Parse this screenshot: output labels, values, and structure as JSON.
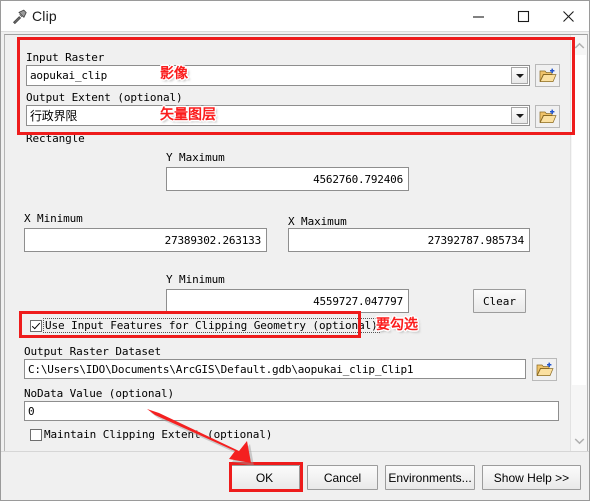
{
  "window": {
    "title": "Clip",
    "icon": "hammer-icon",
    "controls": {
      "minimize": "minimize-icon",
      "maximize": "maximize-icon",
      "close": "close-icon"
    }
  },
  "form": {
    "input_raster": {
      "label": "Input Raster",
      "value": "aopukai_clip",
      "browse_icon": "folder-open-add-icon",
      "dropdown_icon": "chevron-down-icon"
    },
    "output_extent": {
      "label": "Output Extent (optional)",
      "value": "行政界限",
      "browse_icon": "folder-open-add-icon",
      "dropdown_icon": "chevron-down-icon"
    },
    "rectangle": {
      "label": "Rectangle",
      "y_maximum": {
        "label": "Y Maximum",
        "value": "4562760.792406"
      },
      "x_minimum": {
        "label": "X Minimum",
        "value": "27389302.263133"
      },
      "x_maximum": {
        "label": "X Maximum",
        "value": "27392787.985734"
      },
      "y_minimum": {
        "label": "Y Minimum",
        "value": "4559727.047797"
      },
      "clear_button": "Clear"
    },
    "use_input_features": {
      "label": "Use Input Features for Clipping Geometry (optional)",
      "checked": "true"
    },
    "output_raster_dataset": {
      "label": "Output Raster Dataset",
      "value": "C:\\Users\\IDO\\Documents\\ArcGIS\\Default.gdb\\aopukai_clip_Clip1",
      "browse_icon": "folder-open-add-icon"
    },
    "nodata_value": {
      "label": "NoData Value (optional)",
      "value": "0"
    },
    "maintain_clipping_extent": {
      "label": "Maintain Clipping Extent (optional)",
      "checked": "false"
    }
  },
  "footer": {
    "ok": "OK",
    "cancel": "Cancel",
    "environments": "Environments...",
    "show_help": "Show Help >>"
  },
  "scrollbar": {
    "up_icon": "chevron-up-icon",
    "down_icon": "chevron-down-icon"
  },
  "annotations": {
    "note_image": "影像",
    "note_vector_layer": "矢量图层",
    "note_must_check": "要勾选",
    "accent_color": "#ee1c1c"
  }
}
